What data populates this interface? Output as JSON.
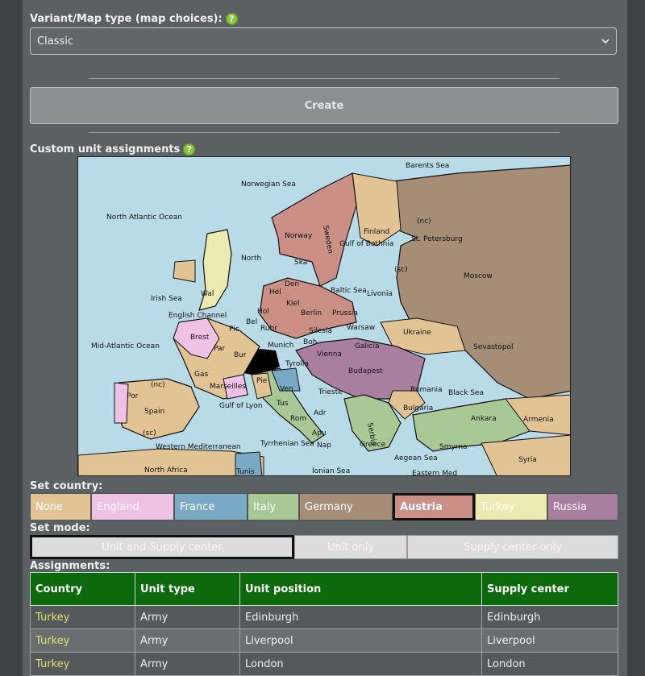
{
  "variant": {
    "label": "Variant/Map type (map choices):",
    "help": "?",
    "selected": "Classic"
  },
  "create_label": "Create",
  "custom": {
    "label": "Custom unit assignments",
    "help": "?"
  },
  "map_labels": {
    "barents": "Barents Sea",
    "norwegian": "Norwegian Sea",
    "north_atlantic": "North Atlantic Ocean",
    "finland": "Finland",
    "st_petersburg": "St. Petersburg",
    "nc": "(nc)",
    "sc": "(sc)",
    "norway": "Norway",
    "sweden": "Sweden",
    "gulf_bothnia": "Gulf of Bothnia",
    "north": "North",
    "ska": "Ska",
    "hel": "Hel",
    "den": "Den",
    "baltic": "Baltic Sea",
    "livonia": "Livonia",
    "moscow": "Moscow",
    "irish": "Irish Sea",
    "wal": "Wal",
    "hol": "Hol",
    "kiel": "Kiel",
    "berlin": "Berlin",
    "prussia": "Prussia",
    "english_channel": "English Channel",
    "bel": "Bel",
    "ruhr": "Ruhr",
    "silesia": "Silesia",
    "warsaw": "Warsaw",
    "ukraine": "Ukraine",
    "mid_atlantic": "Mid-Atlantic Ocean",
    "brest": "Brest",
    "pic": "Pic",
    "par": "Par",
    "bur": "Bur",
    "munich": "Munich",
    "boh": "Boh",
    "galicia": "Galicia",
    "sevastopol": "Sevastopol",
    "tyrolia": "Tyrolia",
    "vienna": "Vienna",
    "budapest": "Budapest",
    "gas": "Gas",
    "marseilles": "Marseilles",
    "pie": "Pie",
    "ven": "Ven",
    "trieste": "Trieste",
    "rumania": "Rumania",
    "black_sea": "Black Sea",
    "por": "Por",
    "spain": "Spain",
    "gulf_lyon": "Gulf of Lyon",
    "tus": "Tus",
    "rom": "Rom",
    "adr": "Adr",
    "serbia": "Serbia",
    "bulgaria": "Bulgaria",
    "ankara": "Ankara",
    "armenia": "Armenia",
    "apu": "Apu",
    "smyrna": "Smyrna",
    "western_med": "Western Mediterranean",
    "tyrrhenian": "Tyrrhenian Sea",
    "nap": "Nap",
    "greece": "Greece",
    "aegean": "Aegean Sea",
    "north_africa": "North Africa",
    "tunis": "Tunis",
    "ionian": "Ionian Sea",
    "eastern_med": "Eastern Med",
    "syria": "Syria"
  },
  "set_country": {
    "label": "Set country:",
    "buttons": [
      {
        "label": "None",
        "color": "#e2c393"
      },
      {
        "label": "England",
        "color": "#efc1e4"
      },
      {
        "label": "France",
        "color": "#79a9c4"
      },
      {
        "label": "Italy",
        "color": "#a8c895"
      },
      {
        "label": "Germany",
        "color": "#a58d76"
      },
      {
        "label": "Austria",
        "color": "#cc8f86"
      },
      {
        "label": "Turkey",
        "color": "#eaeab1"
      },
      {
        "label": "Russia",
        "color": "#a97fa0"
      }
    ],
    "selected": "Austria"
  },
  "set_mode": {
    "label": "Set mode:",
    "buttons": [
      {
        "label": "Unit and Supply center"
      },
      {
        "label": "Unit only"
      },
      {
        "label": "Supply center only"
      }
    ]
  },
  "assignments": {
    "label": "Assignments:",
    "headers": [
      "Country",
      "Unit type",
      "Unit position",
      "Supply center"
    ],
    "rows": [
      {
        "country": "Turkey",
        "unit_type": "Army",
        "position": "Edinburgh",
        "supply": "Edinburgh"
      },
      {
        "country": "Turkey",
        "unit_type": "Army",
        "position": "Liverpool",
        "supply": "Liverpool"
      },
      {
        "country": "Turkey",
        "unit_type": "Army",
        "position": "London",
        "supply": "London"
      }
    ]
  },
  "colors": {
    "england": "#efc1e4",
    "france": "#79a9c4",
    "italy": "#a8c895",
    "germany": "#a58d76",
    "austria": "#cc8f86",
    "turkey": "#eaeab1",
    "russia": "#a97fa0",
    "neutral": "#e2c393",
    "sea": "#b9dbe8",
    "header_green": "#0c6a0c"
  }
}
